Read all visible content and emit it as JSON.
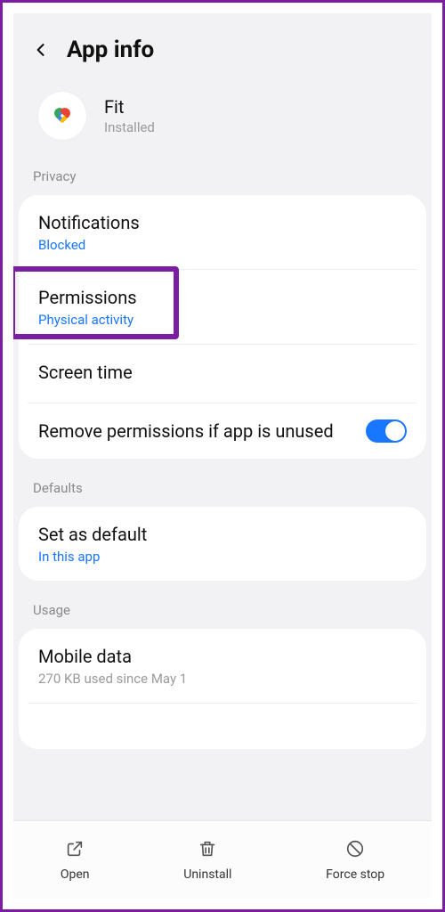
{
  "header": {
    "title": "App info"
  },
  "app": {
    "name": "Fit",
    "status": "Installed"
  },
  "sections": {
    "privacy": {
      "label": "Privacy",
      "notifications": {
        "title": "Notifications",
        "sub": "Blocked"
      },
      "permissions": {
        "title": "Permissions",
        "sub": "Physical activity"
      },
      "screen_time": {
        "title": "Screen time"
      },
      "remove_perms": {
        "title": "Remove permissions if app is unused"
      }
    },
    "defaults": {
      "label": "Defaults",
      "set_default": {
        "title": "Set as default",
        "sub": "In this app"
      }
    },
    "usage": {
      "label": "Usage",
      "mobile_data": {
        "title": "Mobile data",
        "sub": "270 KB used since May 1"
      }
    }
  },
  "actions": {
    "open": "Open",
    "uninstall": "Uninstall",
    "force_stop": "Force stop"
  },
  "colors": {
    "accent": "#1976ff",
    "highlight": "#7b1fa2"
  }
}
